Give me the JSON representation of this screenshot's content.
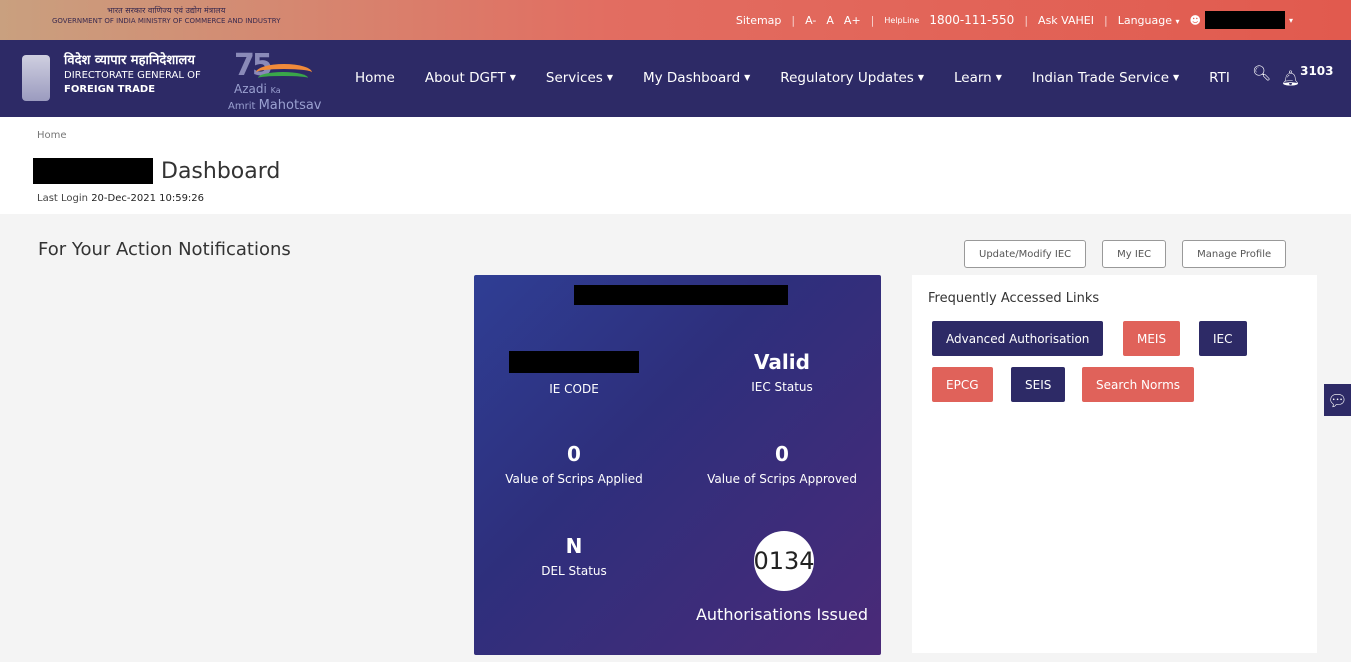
{
  "topbar": {
    "gov_hindi": "भारत सरकार  वाणिज्य एवं उद्योग मंत्रालय",
    "gov_english": "GOVERNMENT OF INDIA  MINISTRY OF COMMERCE AND INDUSTRY",
    "sitemap": "Sitemap",
    "font_small": "A-",
    "font_normal": "A",
    "font_large": "A+",
    "helpline_label": "HelpLine",
    "helpline_number": "1800-111-550",
    "ask_vahei": "Ask VAHEI",
    "language": "Language"
  },
  "nav": {
    "org_hindi": "विदेश व्यापार महानिदेशालय",
    "org_line1": "DIRECTORATE GENERAL OF",
    "org_line2": "FOREIGN TRADE",
    "azadi_75": "75",
    "azadi_line1": "Azadi",
    "azadi_ka": "Ka",
    "azadi_amrit": "Amrit",
    "azadi_mahotsav": "Mahotsav",
    "items": [
      {
        "label": "Home",
        "caret": false
      },
      {
        "label": "About DGFT",
        "caret": true
      },
      {
        "label": "Services",
        "caret": true
      },
      {
        "label": "My Dashboard",
        "caret": true
      },
      {
        "label": "Regulatory Updates",
        "caret": true
      },
      {
        "label": "Learn",
        "caret": true
      },
      {
        "label": "Indian Trade Service",
        "caret": true
      },
      {
        "label": "RTI",
        "caret": false
      }
    ],
    "notification_count": "3103"
  },
  "page": {
    "breadcrumb": "Home",
    "title": "Dashboard",
    "last_login_label": "Last Login",
    "last_login_value": "20-Dec-2021 10:59:26",
    "notifications_title": "For Your Action Notifications"
  },
  "actions": {
    "update_iec": "Update/Modify IEC",
    "my_iec": "My IEC",
    "manage_profile": "Manage Profile"
  },
  "card": {
    "ie_code_label": "IE CODE",
    "iec_status_value": "Valid",
    "iec_status_label": "IEC Status",
    "scrips_applied_value": "0",
    "scrips_applied_label": "Value of Scrips Applied",
    "scrips_approved_value": "0",
    "scrips_approved_label": "Value of Scrips Approved",
    "del_status_value": "N",
    "del_status_label": "DEL Status",
    "authorisations_value": "0134",
    "authorisations_label": "Authorisations Issued"
  },
  "links": {
    "title": "Frequently Accessed Links",
    "advanced_authorisation": "Advanced Authorisation",
    "meis": "MEIS",
    "iec": "IEC",
    "epcg": "EPCG",
    "seis": "SEIS",
    "search_norms": "Search Norms"
  },
  "colors": {
    "nav_bg": "#2d2a66",
    "topbar_red": "#e15a4e",
    "chip_red": "#e0625a"
  }
}
